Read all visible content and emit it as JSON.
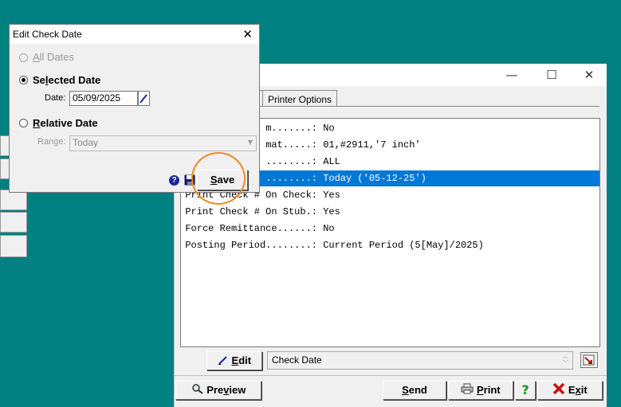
{
  "main_window": {
    "controls": {
      "minimize": "—",
      "maximize": "☐",
      "close": "✕"
    },
    "tabs": [
      "Printer Options"
    ],
    "rows": [
      {
        "label": "m.......:",
        "value": "No",
        "selected": false
      },
      {
        "label": "mat.....:",
        "value": "01,#2911,'7 inch'",
        "selected": false
      },
      {
        "label": "........:",
        "value": "ALL",
        "selected": false
      },
      {
        "label": "........:",
        "value": "Today ('05-12-25')",
        "selected": true
      },
      {
        "label": "Print Check # On Check:",
        "value": "Yes",
        "selected": false
      },
      {
        "label": "Print Check # On Stub.:",
        "value": "Yes",
        "selected": false
      },
      {
        "label": "Force Remittance......:",
        "value": "No",
        "selected": false
      },
      {
        "label": "Posting Period........:",
        "value": "Current Period (5[May]/2025)",
        "selected": false
      }
    ],
    "edit_button": {
      "prefix": "",
      "underline": "E",
      "rest": "dit"
    },
    "description": "Check Date",
    "preview_button": {
      "prefix": "Pre",
      "underline": "v",
      "rest": "iew"
    },
    "send_button": {
      "prefix": "",
      "underline": "S",
      "rest": "end"
    },
    "print_button": {
      "prefix": "",
      "underline": "P",
      "rest": "rint"
    },
    "help_button": {
      "label": "?"
    },
    "exit_button": {
      "prefix": "E",
      "underline": "x",
      "rest": "it"
    }
  },
  "dialog": {
    "title": "Edit Check Date",
    "close": "✕",
    "all_dates": {
      "prefix": "",
      "underline": "A",
      "rest": "ll Dates",
      "checked": false,
      "disabled": true
    },
    "selected_date": {
      "prefix": "Se",
      "underline": "l",
      "rest": "ected Date",
      "checked": true
    },
    "date_label": "Date:",
    "date_value": "05/09/2025",
    "relative_date": {
      "prefix": "",
      "underline": "R",
      "rest": "elative Date",
      "checked": false
    },
    "range_label": "Range:",
    "range_value": "Today",
    "help_icon": "?",
    "save_button": {
      "prefix": "",
      "underline": "S",
      "rest": "ave"
    }
  },
  "colors": {
    "desktop": "#008080",
    "selection": "#0078d7",
    "highlight_ring": "#ef8a2a"
  }
}
